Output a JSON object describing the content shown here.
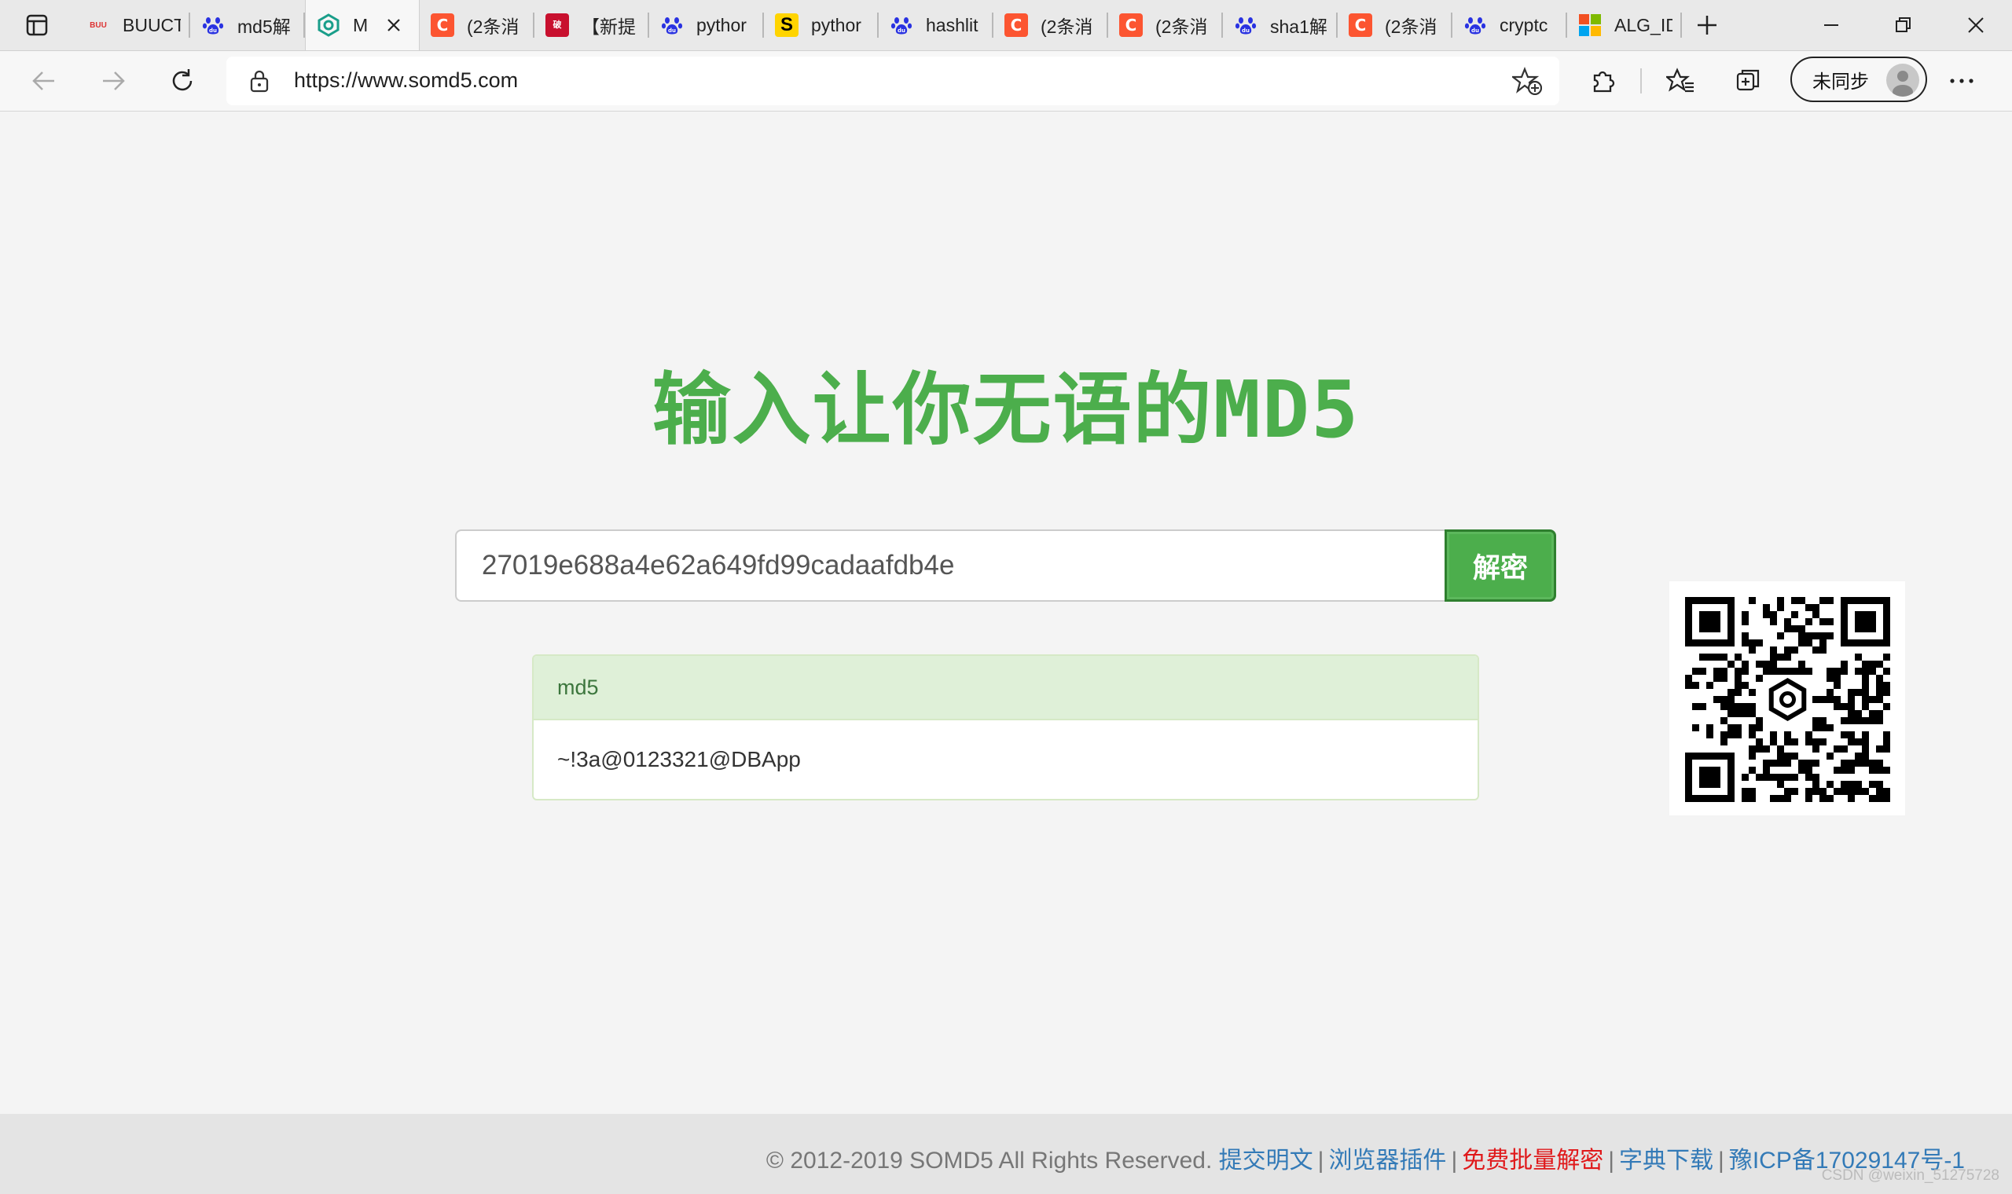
{
  "browser": {
    "tabs": [
      {
        "title": "BUUCT",
        "icon": "buuctf-icon",
        "glyph": "BUU"
      },
      {
        "title": "md5解",
        "icon": "baidu-paw-icon"
      },
      {
        "title": "M",
        "icon": "somd5-icon",
        "active": true
      },
      {
        "title": "(2条消",
        "icon": "csdn-icon",
        "glyph": "C"
      },
      {
        "title": "【新提",
        "icon": "red-seal-icon",
        "glyph": "破"
      },
      {
        "title": "pythor",
        "icon": "baidu-paw-icon"
      },
      {
        "title": "pythor",
        "icon": "python-site-icon",
        "glyph": "S"
      },
      {
        "title": "hashlit",
        "icon": "baidu-paw-icon"
      },
      {
        "title": "(2条消",
        "icon": "csdn-icon",
        "glyph": "C"
      },
      {
        "title": "(2条消",
        "icon": "csdn-icon",
        "glyph": "C"
      },
      {
        "title": "sha1解",
        "icon": "baidu-paw-icon"
      },
      {
        "title": "(2条消",
        "icon": "csdn-icon",
        "glyph": "C"
      },
      {
        "title": "cryptc",
        "icon": "baidu-paw-icon"
      },
      {
        "title": "ALG_ID",
        "icon": "microsoft-icon"
      }
    ],
    "url": "https://www.somd5.com",
    "sync_label": "未同步"
  },
  "page": {
    "title": "输入让你无语的MD5",
    "search_value": "27019e688a4e62a649fd99cadaafdb4e",
    "decrypt_button": "解密",
    "result": {
      "type_label": "md5",
      "plaintext": "~!3a@0123321@DBApp"
    }
  },
  "footer": {
    "copyright": "© 2012-2019 SOMD5 All Rights Reserved.",
    "links": [
      {
        "label": "提交明文",
        "color": "#337ab7"
      },
      {
        "label": "浏览器插件",
        "color": "#337ab7"
      },
      {
        "label": "免费批量解密",
        "color": "#e0191b"
      },
      {
        "label": "字典下载",
        "color": "#337ab7"
      },
      {
        "label": "豫ICP备17029147号-1",
        "color": "#337ab7"
      }
    ],
    "separator": "|"
  },
  "watermark": "CSDN @weixin_51275728",
  "colors": {
    "accent_green": "#4cae4c",
    "panel_head_bg": "#dff0d8",
    "link_blue": "#337ab7",
    "link_red": "#e0191b"
  }
}
